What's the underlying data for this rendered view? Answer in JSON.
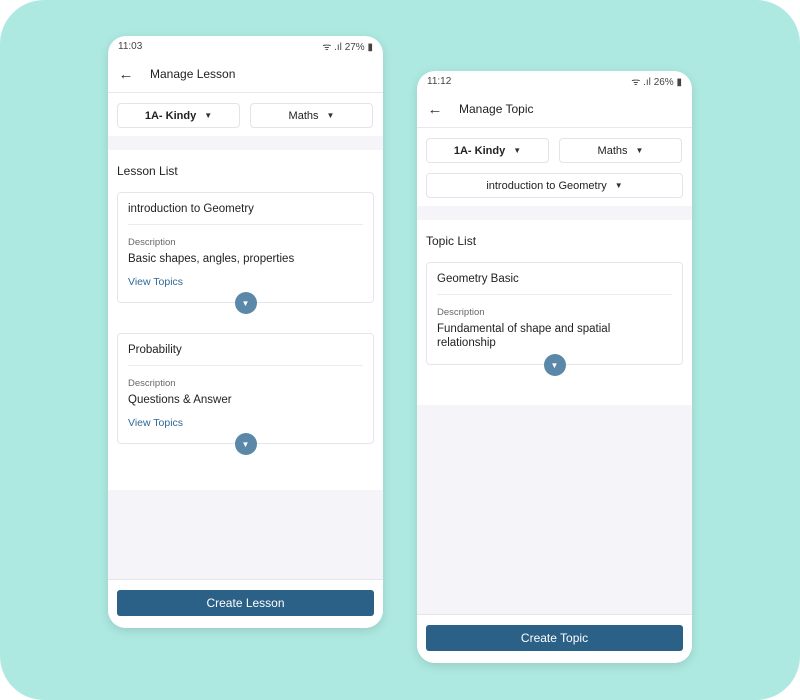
{
  "colors": {
    "background": "#ade9e1",
    "primary": "#2b6087",
    "accent_link": "#2f6a96",
    "expand_button": "#5b87a8"
  },
  "icons": {
    "back": "arrow-left-icon",
    "caret": "caret-down-icon",
    "expand": "chevron-down-icon",
    "wifi": "wifi-icon",
    "signal": "signal-icon",
    "battery": "battery-icon"
  },
  "lesson_screen": {
    "status": {
      "time": "11:03",
      "battery": "27%"
    },
    "title": "Manage Lesson",
    "filters": {
      "class": "1A- Kindy",
      "subject": "Maths"
    },
    "section_title": "Lesson List",
    "lessons": [
      {
        "title": "introduction  to Geometry",
        "description_label": "Description",
        "description": "Basic shapes, angles, properties",
        "link": "View Topics"
      },
      {
        "title": "Probability",
        "description_label": "Description",
        "description": "Questions  & Answer",
        "link": "View Topics"
      }
    ],
    "cta": "Create Lesson"
  },
  "topic_screen": {
    "status": {
      "time": "11:12",
      "battery": "26%"
    },
    "title": "Manage Topic",
    "filters": {
      "class": "1A- Kindy",
      "subject": "Maths",
      "lesson": "introduction  to Geometry"
    },
    "section_title": "Topic List",
    "topics": [
      {
        "title": "Geometry  Basic",
        "description_label": "Description",
        "description": "Fundamental  of shape and spatial relationship"
      }
    ],
    "cta": "Create Topic"
  }
}
